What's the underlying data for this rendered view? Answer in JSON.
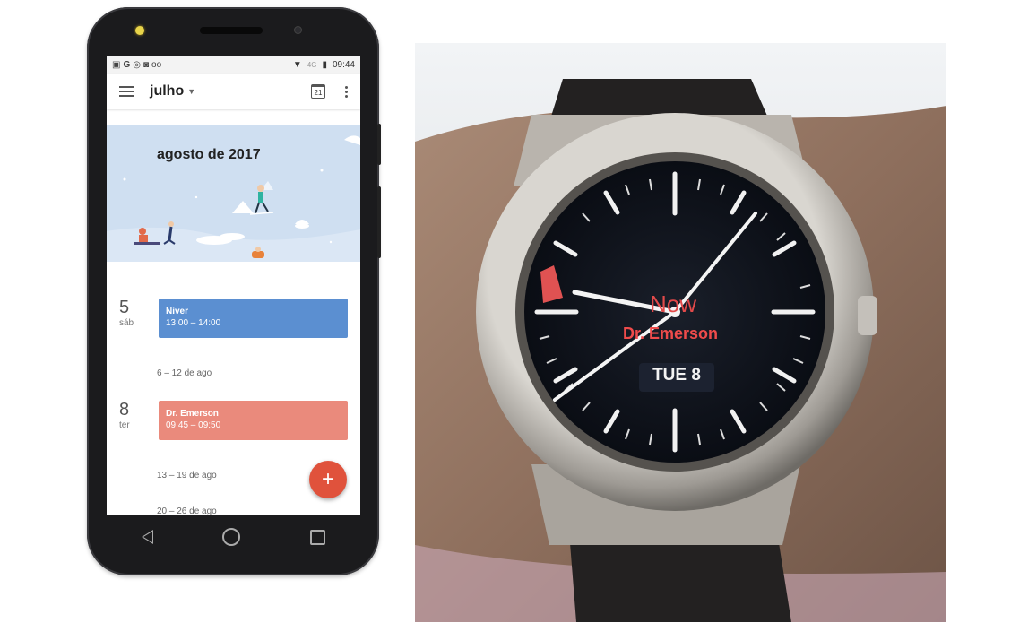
{
  "phone": {
    "status_bar": {
      "left_icons": [
        "gallery-icon",
        "G",
        "whatsapp-icon",
        "instagram-icon",
        "voicemail-icon"
      ],
      "network": "4G",
      "time": "09:44"
    },
    "app_bar": {
      "month": "julho",
      "calendar_icon_day": "21"
    },
    "banner": {
      "title": "agosto de 2017"
    },
    "days": [
      {
        "day": "5",
        "weekday": "sáb",
        "event": {
          "title": "Niver",
          "time": "13:00 – 14:00",
          "color": "#5b8fd1"
        }
      },
      {
        "day": "8",
        "weekday": "ter",
        "event": {
          "title": "Dr. Emerson",
          "time": "09:45 – 09:50",
          "color": "#ea8a7c"
        }
      }
    ],
    "week_labels": [
      "6 – 12 de ago",
      "13 – 19 de ago",
      "20 – 26 de ago"
    ],
    "fab_label": "+"
  },
  "watch": {
    "now_label": "Now",
    "event_label": "Dr. Emerson",
    "date_label": "TUE 8"
  }
}
